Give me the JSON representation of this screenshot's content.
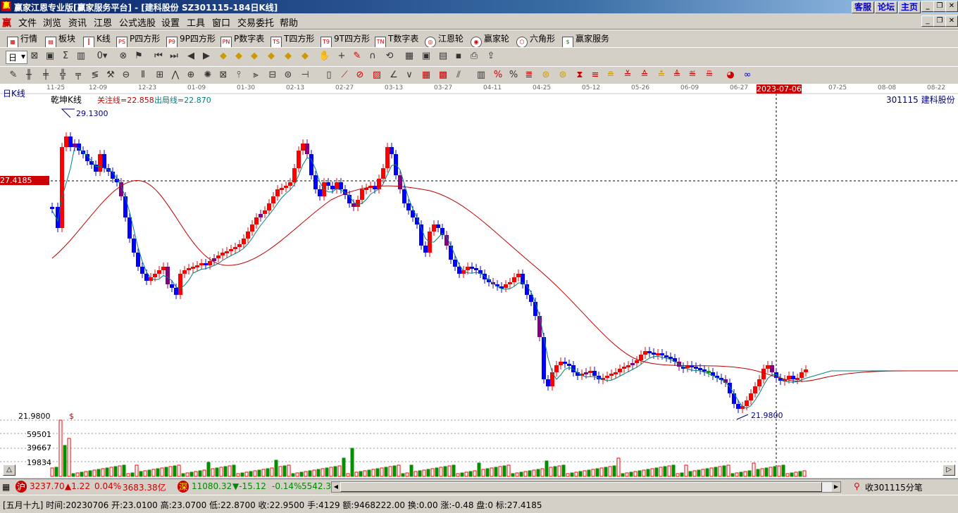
{
  "window": {
    "title": "赢家江恩专业版[赢家服务平台] - [建科股份   SZ301115-184日K线]",
    "app_icon": "赢",
    "links": [
      "客服",
      "论坛",
      "主页"
    ]
  },
  "menu": [
    "文件",
    "浏览",
    "资讯",
    "江恩",
    "公式选股",
    "设置",
    "工具",
    "窗口",
    "交易委托",
    "帮助"
  ],
  "menu_icon": "赢",
  "toolbar1": [
    {
      "label": "行情",
      "icon": "quote-grid-icon"
    },
    {
      "label": "板块",
      "icon": "sector-icon"
    },
    {
      "label": "K线",
      "icon": "kline-icon"
    },
    {
      "label": "P四方形",
      "icon": "P-square-icon",
      "tag": "PS"
    },
    {
      "label": "9P四方形",
      "icon": "9P-square-icon",
      "tag": "P9"
    },
    {
      "label": "P数字表",
      "icon": "P-number-table-icon",
      "tag": "PN"
    },
    {
      "label": "T四方形",
      "icon": "T-square-icon",
      "tag": "TS"
    },
    {
      "label": "9T四方形",
      "icon": "9T-square-icon",
      "tag": "T9"
    },
    {
      "label": "T数字表",
      "icon": "T-number-table-icon",
      "tag": "TN"
    },
    {
      "label": "江恩轮",
      "icon": "gann-wheel-icon"
    },
    {
      "label": "赢家轮",
      "icon": "winner-wheel-icon"
    },
    {
      "label": "六角形",
      "icon": "hexagon-icon"
    },
    {
      "label": "赢家服务",
      "icon": "service-icon"
    }
  ],
  "period_select": "日",
  "chart": {
    "period_label": "日K线",
    "indicator_name": "乾坤K线",
    "watch_line": "关注线=22.858",
    "exit_line": "出局线=22.870",
    "stock_label": "301115  建科股份",
    "crosshair_date": "2023-07-06",
    "crosshair_price": "27.4185",
    "high_label": "29.1300",
    "low_label": "21.9800",
    "volume_axis_top": "21.9800",
    "volume_marker": "$",
    "volume_ticks": [
      "59501",
      "39667",
      "19834"
    ],
    "dates": [
      "11-25",
      "12-09",
      "12-23",
      "01-09",
      "01-30",
      "02-13",
      "02-27",
      "03-13",
      "03-27",
      "04-11",
      "04-25",
      "05-12",
      "05-26",
      "06-09",
      "06-27",
      "07-25",
      "08-08",
      "08-22"
    ],
    "colors": {
      "up": "#ff0000",
      "down": "#0000ff",
      "neutral": "#800080",
      "ma_short": "#008080",
      "ma_long": "#c00000",
      "volume": "#009000"
    }
  },
  "chart_data": {
    "type": "candlestick",
    "description_values": {
      "ylim": [
        21.98,
        29.13
      ],
      "crosshair": 27.4185,
      "watch_line": 22.858,
      "exit_line": 22.87
    },
    "volume_range": [
      0,
      79334
    ]
  },
  "status1": {
    "sh_icon": "沪",
    "sh_index": "3237.70",
    "sh_change": "▲1.22",
    "sh_pct": "0.04%",
    "sh_amount": "3683.38亿",
    "sz_icon": "深",
    "sz_index": "11080.32",
    "sz_change": "▼-15.12",
    "sz_pct": "-0.14%",
    "sz_amount": "5542.3",
    "ticker_text": "收301115分笔"
  },
  "status2": {
    "info": "[五月十九] 时间:20230706 开:23.0100 高:23.0700 低:22.8700 收:22.9500 手:4129 额:9468222.00 换:0.00 涨:-0.48 盘:0 标:27.4185"
  }
}
